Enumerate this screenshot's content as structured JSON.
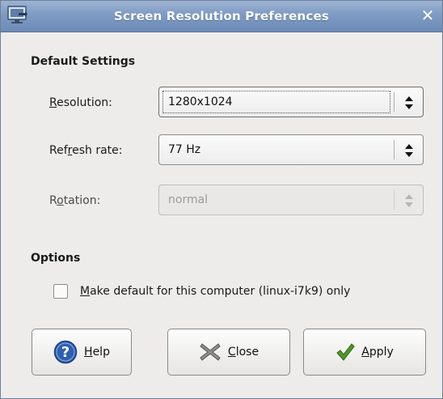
{
  "window": {
    "title": "Screen Resolution Preferences",
    "close_glyph": "✕",
    "icon": "display-preferences-icon"
  },
  "default_settings": {
    "heading": "Default Settings",
    "resolution": {
      "label_first": "R",
      "label_rest": "esolution:",
      "value": "1280x1024"
    },
    "refresh_rate": {
      "label_pre": "Ref",
      "label_u": "r",
      "label_post": "esh rate:",
      "value": "77 Hz"
    },
    "rotation": {
      "label_pre": "R",
      "label_u": "o",
      "label_post": "tation:",
      "value": "normal",
      "disabled": true
    }
  },
  "options": {
    "heading": "Options",
    "checkbox": {
      "label_u": "M",
      "label_rest": "ake default for this computer (linux-i7k9) only",
      "checked": false
    }
  },
  "buttons": {
    "help": {
      "label_u": "H",
      "label_rest": "elp",
      "icon": "help-icon"
    },
    "close": {
      "label_u": "C",
      "label_rest": "lose",
      "icon": "close-icon"
    },
    "apply": {
      "label_u": "A",
      "label_rest": "pply",
      "icon": "checkmark-icon"
    }
  },
  "colors": {
    "titlebar": "#7e9bc3",
    "window_bg": "#edeceb",
    "help_icon": "#2f5fb0",
    "apply_check": "#3d7a1e"
  }
}
